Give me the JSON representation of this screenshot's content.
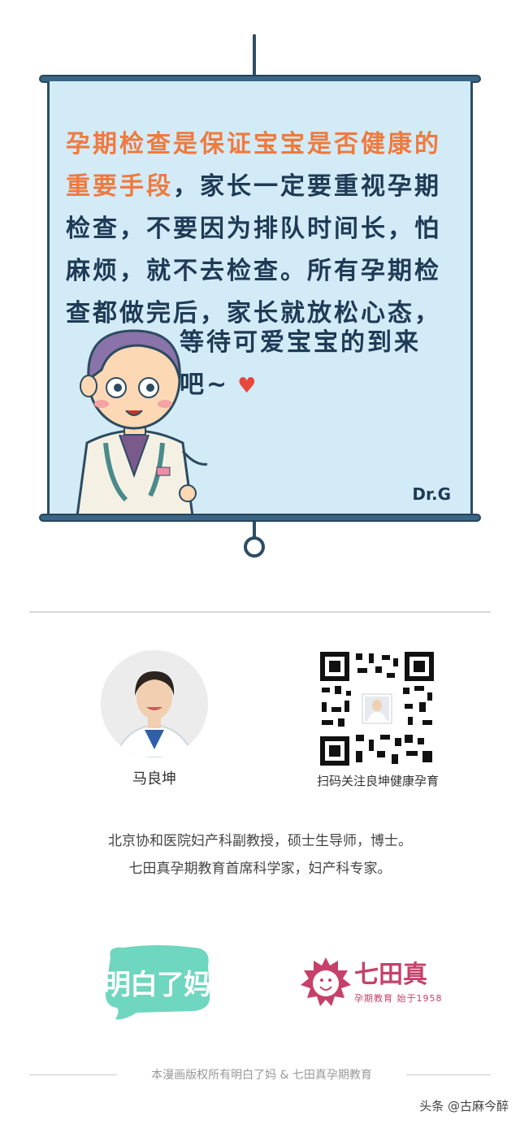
{
  "poster": {
    "text_highlight": "孕期检查是保证宝宝是否健康的重要手段",
    "text_body": "，家长一定要重视孕期检查，不要因为排队时间长，怕麻烦，就不去检查。所有孕期检查都做完后，家长就放松心态，",
    "text_tail_line1": "等待可爱宝宝的到来",
    "text_tail_line2": "吧~",
    "heart_icon": "♥",
    "signature": "Dr.G"
  },
  "profile": {
    "name": "马良坤",
    "qr_caption": "扫码关注良坤健康孕育",
    "bio_line1": "北京协和医院妇产科副教授，硕士生导师，博士。",
    "bio_line2": "七田真孕期教育首席科学家，妇产科专家。"
  },
  "logos": {
    "left_text": "明白了妈",
    "right_title": "七田真",
    "right_sub": "孕期教育 始于1958"
  },
  "footer": {
    "copyright": "本漫画版权所有明白了妈 & 七田真孕期教育",
    "watermark": "头条 @古麻今醉"
  },
  "colors": {
    "panel_bg": "#d3ebf6",
    "highlight_text": "#ef7a3e",
    "body_text": "#1f3a56",
    "logo_left": "#6fd6bf",
    "logo_right": "#c6416a"
  }
}
